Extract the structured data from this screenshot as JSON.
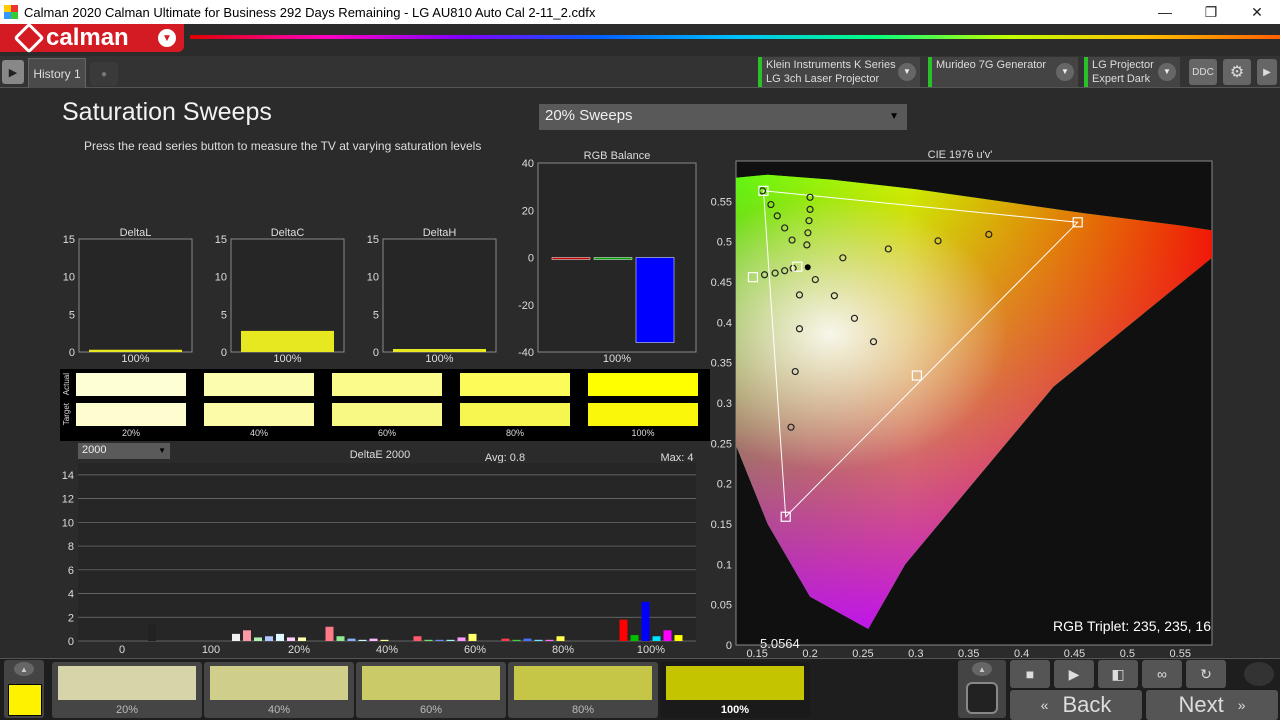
{
  "window": {
    "title": "Calman 2020 Calman Ultimate for Business 292 Days Remaining  - LG AU810 Auto Cal 2-11_2.cdfx",
    "minimize": "—",
    "maximize": "❐",
    "close": "✕"
  },
  "logo": {
    "text": "calman",
    "dropdown": "▼"
  },
  "tabs": {
    "history": "History 1"
  },
  "devices": [
    {
      "line1": "Klein Instruments K Series",
      "line2": "LG  3ch Laser Projector"
    },
    {
      "line1": "Murideo 7G Generator",
      "line2": ""
    },
    {
      "line1": "LG Projector",
      "line2": "Expert Dark"
    }
  ],
  "toolbar": {
    "ddc": "DDC",
    "settings_icon": "gear-icon"
  },
  "page": {
    "title": "Saturation Sweeps",
    "instructions": "Press the read series button to measure the TV at varying saturation levels",
    "sweep_select": "20% Sweeps"
  },
  "delta_charts": [
    {
      "title": "DeltaL",
      "xlabel": "100%",
      "ticks": [
        "15",
        "10",
        "5",
        "0"
      ]
    },
    {
      "title": "DeltaC",
      "xlabel": "100%",
      "ticks": [
        "15",
        "10",
        "5",
        "0"
      ]
    },
    {
      "title": "DeltaH",
      "xlabel": "100%",
      "ticks": [
        "15",
        "10",
        "5",
        "0"
      ]
    }
  ],
  "rgb_balance": {
    "title": "RGB Balance",
    "xlabel": "100%",
    "ticks": [
      "40",
      "20",
      "0",
      "-20",
      "-40"
    ]
  },
  "swatches": {
    "actual_label": "Actual",
    "target_label": "Target",
    "labels": [
      "20%",
      "40%",
      "60%",
      "80%",
      "100%"
    ],
    "actual_colors": [
      "#ffffd6",
      "#fdfdb0",
      "#fbfb8c",
      "#fbfb5a",
      "#ffff00"
    ],
    "target_colors": [
      "#fdfdcf",
      "#fbfba8",
      "#f8f884",
      "#f6f650",
      "#fbf70a"
    ]
  },
  "deltae": {
    "select": "2000",
    "title": "DeltaE 2000",
    "avg": "Avg: 0.8",
    "max": "Max: 4",
    "yticks": [
      "14",
      "12",
      "10",
      "8",
      "6",
      "4",
      "2",
      "0"
    ],
    "xticks": [
      "0",
      "100",
      "20%",
      "40%",
      "60%",
      "80%",
      "100%"
    ]
  },
  "cie": {
    "title": "CIE 1976 u'v'",
    "yticks": [
      "0.55",
      "0.5",
      "0.45",
      "0.4",
      "0.35",
      "0.3",
      "0.25",
      "0.2",
      "0.15",
      "0.1",
      "0.05",
      "0"
    ],
    "xticks": [
      "0.15",
      "0.2",
      "0.25",
      "0.3",
      "0.35",
      "0.4",
      "0.45",
      "0.5",
      "0.55"
    ],
    "rgb_triplet": "RGB Triplet: 235, 235, 16",
    "readout": "5.0564"
  },
  "bottom": {
    "current_color": "#fff200",
    "swatches": [
      {
        "label": "20%",
        "color": "#d5d5a9"
      },
      {
        "label": "40%",
        "color": "#cfcf8b"
      },
      {
        "label": "60%",
        "color": "#caca66"
      },
      {
        "label": "80%",
        "color": "#c5c548"
      },
      {
        "label": "100%",
        "color": "#c4c400"
      }
    ],
    "back": "Back",
    "next": "Next"
  },
  "chart_data": [
    {
      "type": "bar",
      "title": "DeltaL",
      "categories": [
        "100%"
      ],
      "values": [
        0.3
      ],
      "ylim": [
        0,
        15
      ]
    },
    {
      "type": "bar",
      "title": "DeltaC",
      "categories": [
        "100%"
      ],
      "values": [
        2.8
      ],
      "ylim": [
        0,
        15
      ]
    },
    {
      "type": "bar",
      "title": "DeltaH",
      "categories": [
        "100%"
      ],
      "values": [
        0.4
      ],
      "ylim": [
        0,
        15
      ]
    },
    {
      "type": "bar",
      "title": "RGB Balance",
      "categories": [
        "100%"
      ],
      "series": [
        {
          "color": "#c00000",
          "values": [
            -0.5
          ]
        },
        {
          "color": "#00a000",
          "values": [
            -0.8
          ]
        },
        {
          "color": "#0000ff",
          "values": [
            -36
          ]
        }
      ],
      "ylim": [
        -40,
        40
      ]
    },
    {
      "type": "bar",
      "title": "DeltaE 2000",
      "ylim": [
        0,
        15
      ],
      "groups": [
        {
          "label": "0",
          "bars": [
            {
              "color": "#222",
              "value": 1.4
            }
          ]
        },
        {
          "label": "100",
          "bars": []
        },
        {
          "label": "20%",
          "bars": [
            {
              "color": "#f0f0f0",
              "value": 0.6
            },
            {
              "color": "#ff9aa5",
              "value": 0.9
            },
            {
              "color": "#b0f0b0",
              "value": 0.3
            },
            {
              "color": "#b0c8ff",
              "value": 0.4
            },
            {
              "color": "#e0f8ff",
              "value": 0.6
            },
            {
              "color": "#ffd0ff",
              "value": 0.3
            },
            {
              "color": "#ffffb0",
              "value": 0.3
            }
          ]
        },
        {
          "label": "40%",
          "bars": [
            {
              "color": "#ff7a88",
              "value": 1.2
            },
            {
              "color": "#90e890",
              "value": 0.4
            },
            {
              "color": "#8ab0ff",
              "value": 0.2
            },
            {
              "color": "#c8f8ff",
              "value": 0.1
            },
            {
              "color": "#ffb8ff",
              "value": 0.2
            },
            {
              "color": "#ffff90",
              "value": 0.1
            }
          ]
        },
        {
          "label": "60%",
          "bars": [
            {
              "color": "#ff5a6a",
              "value": 0.4
            },
            {
              "color": "#70e070",
              "value": 0.1
            },
            {
              "color": "#6a90ff",
              "value": 0.1
            },
            {
              "color": "#a0f0ff",
              "value": 0.1
            },
            {
              "color": "#ff98ff",
              "value": 0.3
            },
            {
              "color": "#ffff70",
              "value": 0.6
            }
          ]
        },
        {
          "label": "80%",
          "bars": [
            {
              "color": "#ff3a4a",
              "value": 0.2
            },
            {
              "color": "#40d040",
              "value": 0.1
            },
            {
              "color": "#4a70ff",
              "value": 0.2
            },
            {
              "color": "#70e8ff",
              "value": 0.1
            },
            {
              "color": "#ff70ff",
              "value": 0.1
            },
            {
              "color": "#ffff50",
              "value": 0.4
            }
          ]
        },
        {
          "label": "100%",
          "bars": [
            {
              "color": "#ff0000",
              "value": 1.8
            },
            {
              "color": "#00c000",
              "value": 0.5
            },
            {
              "color": "#0000ff",
              "value": 3.3
            },
            {
              "color": "#00e0ff",
              "value": 0.4
            },
            {
              "color": "#ff00ff",
              "value": 0.9
            },
            {
              "color": "#ffff00",
              "value": 0.5
            }
          ]
        }
      ]
    },
    {
      "type": "scatter",
      "title": "CIE 1976 u'v'",
      "xlim": [
        0.13,
        0.58
      ],
      "ylim": [
        0,
        0.6
      ],
      "targets": [
        {
          "u": 0.156,
          "v": 0.563
        },
        {
          "u": 0.453,
          "v": 0.524
        },
        {
          "u": 0.177,
          "v": 0.159
        },
        {
          "u": 0.146,
          "v": 0.456
        },
        {
          "u": 0.301,
          "v": 0.334
        },
        {
          "u": 0.188,
          "v": 0.469
        }
      ],
      "measured": [
        {
          "u": 0.155,
          "v": 0.563
        },
        {
          "u": 0.2,
          "v": 0.555
        },
        {
          "u": 0.2,
          "v": 0.54
        },
        {
          "u": 0.199,
          "v": 0.526
        },
        {
          "u": 0.198,
          "v": 0.511
        },
        {
          "u": 0.197,
          "v": 0.496
        },
        {
          "u": 0.163,
          "v": 0.546
        },
        {
          "u": 0.169,
          "v": 0.532
        },
        {
          "u": 0.176,
          "v": 0.517
        },
        {
          "u": 0.183,
          "v": 0.502
        },
        {
          "u": 0.157,
          "v": 0.459
        },
        {
          "u": 0.167,
          "v": 0.461
        },
        {
          "u": 0.176,
          "v": 0.464
        },
        {
          "u": 0.184,
          "v": 0.467
        },
        {
          "u": 0.231,
          "v": 0.48
        },
        {
          "u": 0.274,
          "v": 0.491
        },
        {
          "u": 0.321,
          "v": 0.501
        },
        {
          "u": 0.369,
          "v": 0.509
        },
        {
          "u": 0.205,
          "v": 0.453
        },
        {
          "u": 0.223,
          "v": 0.433
        },
        {
          "u": 0.242,
          "v": 0.405
        },
        {
          "u": 0.26,
          "v": 0.376
        },
        {
          "u": 0.19,
          "v": 0.434
        },
        {
          "u": 0.19,
          "v": 0.392
        },
        {
          "u": 0.186,
          "v": 0.339
        },
        {
          "u": 0.182,
          "v": 0.27
        }
      ]
    }
  ]
}
